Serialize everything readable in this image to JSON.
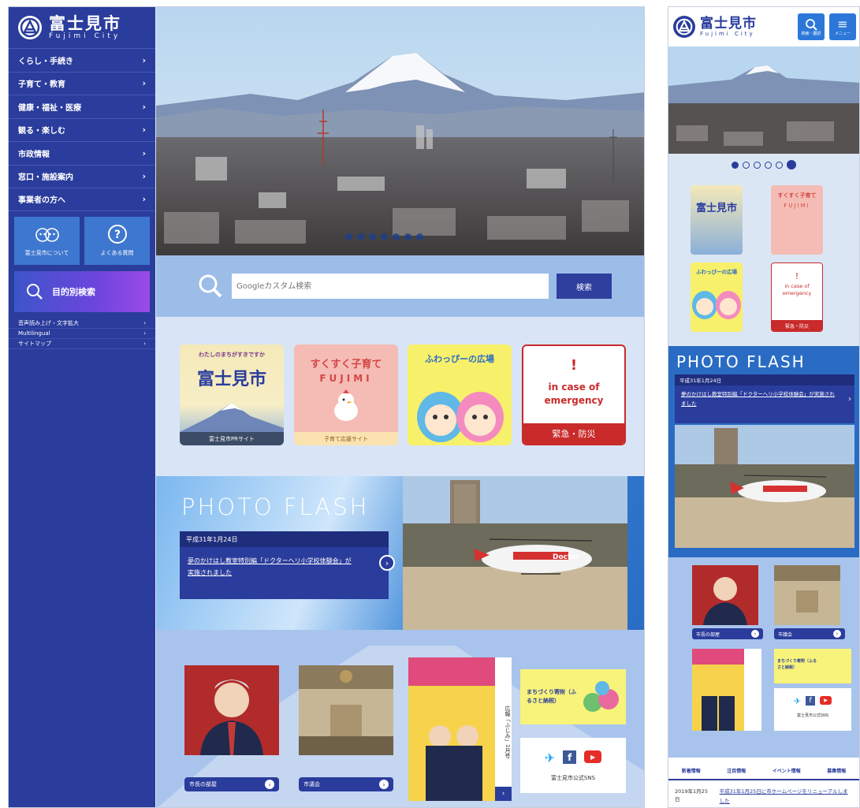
{
  "site": {
    "title": "富士見市",
    "subtitle": "Fujimi City"
  },
  "sidebar": {
    "nav": [
      {
        "label": "くらし・手続き"
      },
      {
        "label": "子育て・教育"
      },
      {
        "label": "健康・福祉・医療"
      },
      {
        "label": "観る・楽しむ"
      },
      {
        "label": "市政情報"
      },
      {
        "label": "窓口・施設案内"
      },
      {
        "label": "事業者の方へ"
      }
    ],
    "quick": [
      {
        "label": "富士見市について",
        "icon": "mascot-icon"
      },
      {
        "label": "よくある質問",
        "icon": "question-icon"
      }
    ],
    "purpose_search": "目的別検索",
    "sub_links": [
      {
        "label": "音声読み上げ・文字拡大"
      },
      {
        "label": "Multilingual"
      },
      {
        "label": "サイトマップ"
      }
    ]
  },
  "search": {
    "placeholder": "Googleカスタム検索",
    "button": "検索"
  },
  "banners": [
    {
      "title": "富士見市",
      "top": "わたしのまちがすきですか",
      "foot": "富士見市PRサイト",
      "color": "#f4e9b8"
    },
    {
      "title": "すくすく子育て",
      "sub": "FUJIMI",
      "foot": "子育て応援サイト",
      "color": "#f4bcb4"
    },
    {
      "title": "ふわっぴーの広場",
      "color": "#f7f06a"
    },
    {
      "title": "in case of emergency",
      "foot": "緊急・防災",
      "color": "#c92a2a"
    }
  ],
  "photo_flash": {
    "title": "PHOTO FLASH",
    "date": "平成31年1月24日",
    "text": "夢のかけはし教室特別編「ドクターヘリ小学校体験会」が実施されました"
  },
  "bottom": {
    "mayor": "市長の部屋",
    "council": "市議会",
    "magazine_side": "広報「ふじみ」1月号",
    "furusato": "まちづくり寄附（ふるさと納税）",
    "sns": "富士見市公式SNS"
  },
  "mobile": {
    "search_label": "検索・翻訳",
    "menu_label": "メニュー",
    "tabs": [
      "新着情報",
      "注目情報",
      "イベント情報",
      "募集情報"
    ],
    "news": [
      {
        "date": "2019年1月25日",
        "text": "平成31年1月25日に市ホームページをリニューアルしました"
      }
    ]
  },
  "colors": {
    "primary": "#2a3c9c",
    "accent": "#2d77d9",
    "band": "#9dbde9",
    "emergency": "#c92a2a"
  }
}
